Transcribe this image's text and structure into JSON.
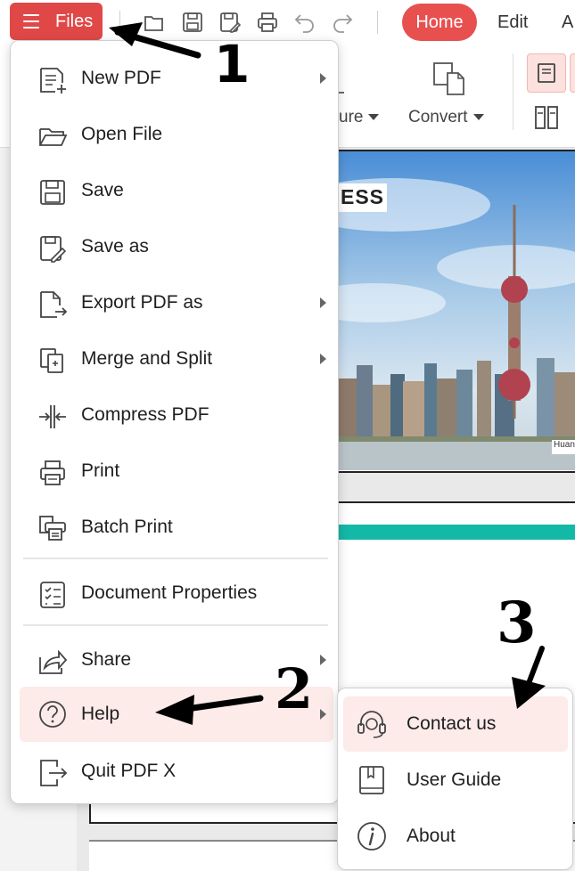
{
  "toolbar": {
    "files_label": "Files",
    "tabs": [
      "Home",
      "Edit",
      "A"
    ],
    "icons": [
      "open-folder-icon",
      "save-icon",
      "save-as-icon",
      "print-icon",
      "undo-icon",
      "redo-icon"
    ]
  },
  "ribbon": {
    "measure_label": "ure",
    "convert_label": "Convert"
  },
  "document": {
    "heading_fragment": "ESS",
    "photo_caption": "Huan"
  },
  "files_menu": {
    "items": [
      {
        "label": "New PDF",
        "icon": "new-pdf-icon",
        "has_submenu": true
      },
      {
        "label": "Open File",
        "icon": "open-file-icon",
        "has_submenu": false
      },
      {
        "label": "Save",
        "icon": "save-icon",
        "has_submenu": false
      },
      {
        "label": "Save as",
        "icon": "save-as-icon",
        "has_submenu": false
      },
      {
        "label": "Export PDF as",
        "icon": "export-icon",
        "has_submenu": true
      },
      {
        "label": "Merge and Split",
        "icon": "merge-icon",
        "has_submenu": true
      },
      {
        "label": "Compress PDF",
        "icon": "compress-icon",
        "has_submenu": false
      },
      {
        "label": "Print",
        "icon": "print-icon",
        "has_submenu": false
      },
      {
        "label": "Batch Print",
        "icon": "batch-print-icon",
        "has_submenu": false
      },
      {
        "label": "Document Properties",
        "icon": "document-properties-icon",
        "has_submenu": false
      },
      {
        "label": "Share",
        "icon": "share-icon",
        "has_submenu": true
      },
      {
        "label": "Help",
        "icon": "help-icon",
        "has_submenu": true,
        "active": true
      },
      {
        "label": "Quit PDF X",
        "icon": "quit-icon",
        "has_submenu": false
      }
    ]
  },
  "help_submenu": {
    "items": [
      {
        "label": "Contact us",
        "icon": "headset-icon",
        "active": true
      },
      {
        "label": "User Guide",
        "icon": "book-icon"
      },
      {
        "label": "About",
        "icon": "info-icon"
      }
    ]
  },
  "annotations": {
    "step1": "1",
    "step2": "2",
    "step3": "3"
  },
  "colors": {
    "accent": "#e04848",
    "tab_active": "#e85050",
    "active_item_bg": "#fcebe9",
    "teal_band": "#14b8a6"
  }
}
